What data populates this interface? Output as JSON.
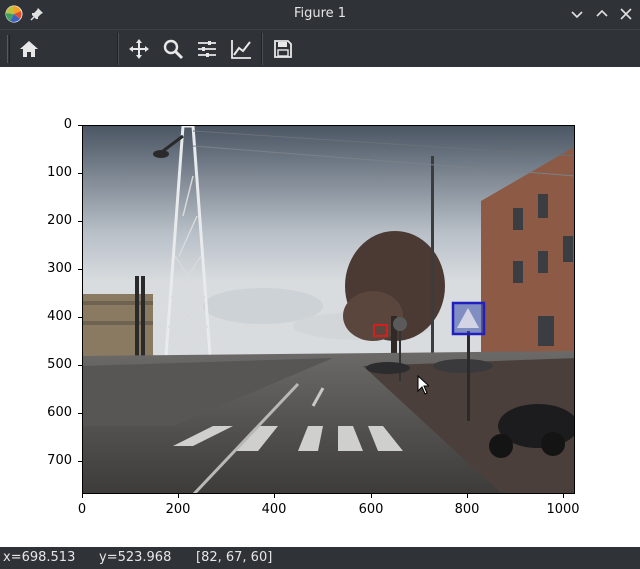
{
  "window": {
    "title": "Figure 1"
  },
  "toolbar": {
    "buttons": [
      {
        "name": "home",
        "icon": "home-icon"
      },
      {
        "name": "pan",
        "icon": "move-icon"
      },
      {
        "name": "zoom",
        "icon": "magnifier-icon"
      },
      {
        "name": "configure-subplots",
        "icon": "sliders-icon"
      },
      {
        "name": "edit-axes",
        "icon": "line-chart-icon"
      },
      {
        "name": "save",
        "icon": "floppy-disk-icon"
      }
    ]
  },
  "axes": {
    "y_ticks": [
      "0",
      "100",
      "200",
      "300",
      "400",
      "500",
      "600",
      "700"
    ],
    "x_ticks": [
      "0",
      "200",
      "400",
      "600",
      "800",
      "1000"
    ],
    "x_range": [
      0,
      1024
    ],
    "y_range": [
      0,
      768
    ]
  },
  "status": {
    "x": "x=698.513",
    "y": "y=523.968",
    "pixel": "[82, 67, 60]"
  },
  "colors": {
    "chrome": "#2f3338",
    "detection_red": "#d02020",
    "detection_blue": "#2020c0"
  }
}
